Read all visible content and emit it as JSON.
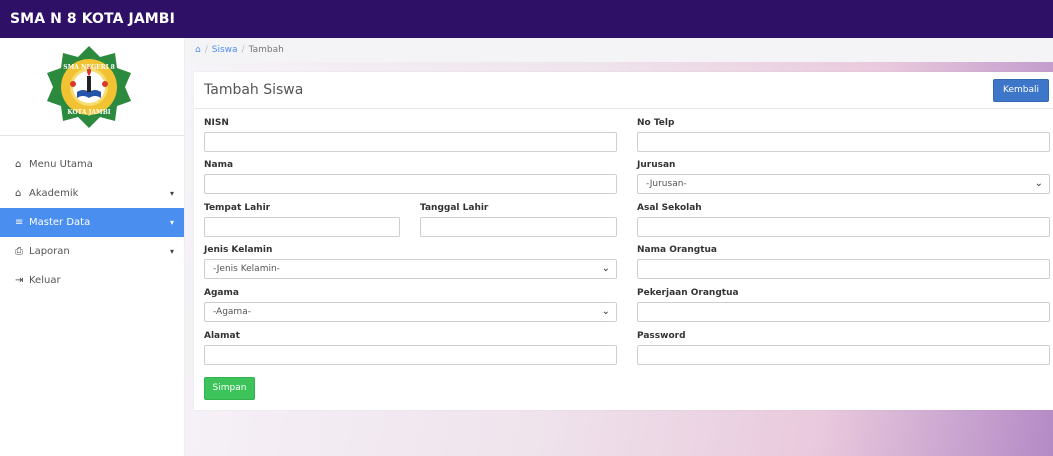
{
  "app": {
    "title": "SMA N 8 KOTA JAMBI"
  },
  "logo": {
    "top_text": "SMA NEGERI 8",
    "bottom_text": "KOTA JAMBI"
  },
  "sidebar": {
    "items": [
      {
        "label": "Menu Utama",
        "icon": "home-icon",
        "glyph": "⌂"
      },
      {
        "label": "Akademik",
        "icon": "bank-icon",
        "glyph": "⌂"
      },
      {
        "label": "Master Data",
        "icon": "database-icon",
        "glyph": "≡"
      },
      {
        "label": "Laporan",
        "icon": "print-icon",
        "glyph": "⎙"
      },
      {
        "label": "Keluar",
        "icon": "sign-out-icon",
        "glyph": "⇥"
      }
    ],
    "caret": "▾"
  },
  "breadcrumb": {
    "home_glyph": "⌂",
    "separator": "/",
    "parent": "Siswa",
    "current": "Tambah"
  },
  "form": {
    "title": "Tambah Siswa",
    "back_label": "Kembali",
    "save_label": "Simpan",
    "fields": {
      "nisn": {
        "label": "NISN",
        "value": ""
      },
      "no_telp": {
        "label": "No Telp",
        "value": ""
      },
      "nama": {
        "label": "Nama",
        "value": ""
      },
      "jurusan": {
        "label": "Jurusan",
        "selected": "-Jurusan-"
      },
      "tempat_lahir": {
        "label": "Tempat Lahir",
        "value": ""
      },
      "tanggal_lahir": {
        "label": "Tanggal Lahir",
        "value": ""
      },
      "asal_sekolah": {
        "label": "Asal Sekolah",
        "value": ""
      },
      "jenis_kelamin": {
        "label": "Jenis Kelamin",
        "selected": "-Jenis Kelamin-"
      },
      "nama_orangtua": {
        "label": "Nama Orangtua",
        "value": ""
      },
      "agama": {
        "label": "Agama",
        "selected": "-Agama-"
      },
      "pekerjaan_orangtua": {
        "label": "Pekerjaan Orangtua",
        "value": ""
      },
      "alamat": {
        "label": "Alamat",
        "value": ""
      },
      "password": {
        "label": "Password",
        "value": ""
      }
    },
    "chevron": "⌄"
  },
  "colors": {
    "topbar": "#2e1166",
    "active_nav": "#4a8ef0",
    "primary_button": "#3e77c9",
    "success_button": "#3cc45a"
  }
}
